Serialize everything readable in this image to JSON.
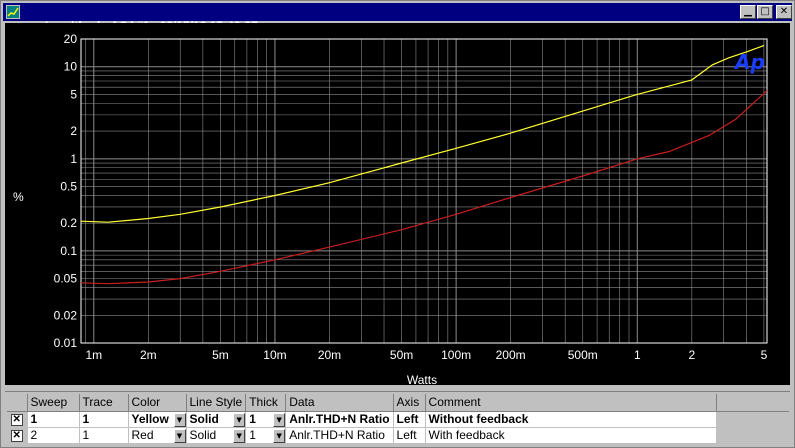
{
  "window": {
    "title_parts": [
      "Loudthud",
      "ACA#1",
      "08/15/12 15:46:27"
    ],
    "controls": [
      "minimize",
      "maximize",
      "close"
    ]
  },
  "chart_data": {
    "type": "line",
    "x_scale": "log",
    "y_scale": "log",
    "xlim": [
      0.00085,
      5.2
    ],
    "ylim": [
      0.01,
      20
    ],
    "xlabel": "Watts",
    "ylabel": "%",
    "x_ticks": [
      {
        "v": 0.001,
        "label": "1m"
      },
      {
        "v": 0.002,
        "label": "2m"
      },
      {
        "v": 0.005,
        "label": "5m"
      },
      {
        "v": 0.01,
        "label": "10m"
      },
      {
        "v": 0.02,
        "label": "20m"
      },
      {
        "v": 0.05,
        "label": "50m"
      },
      {
        "v": 0.1,
        "label": "100m"
      },
      {
        "v": 0.2,
        "label": "200m"
      },
      {
        "v": 0.5,
        "label": "500m"
      },
      {
        "v": 1,
        "label": "1"
      },
      {
        "v": 2,
        "label": "2"
      },
      {
        "v": 5,
        "label": "5"
      }
    ],
    "y_ticks": [
      {
        "v": 20,
        "label": "20"
      },
      {
        "v": 10,
        "label": "10"
      },
      {
        "v": 5,
        "label": "5"
      },
      {
        "v": 2,
        "label": "2"
      },
      {
        "v": 1,
        "label": "1"
      },
      {
        "v": 0.5,
        "label": "0.5"
      },
      {
        "v": 0.2,
        "label": "0.2"
      },
      {
        "v": 0.1,
        "label": "0.1"
      },
      {
        "v": 0.05,
        "label": "0.05"
      },
      {
        "v": 0.02,
        "label": "0.02"
      },
      {
        "v": 0.01,
        "label": "0.01"
      }
    ],
    "grid": true,
    "logo_text": "Ap",
    "series": [
      {
        "color": "#ffff33",
        "x": [
          0.00085,
          0.0012,
          0.002,
          0.003,
          0.005,
          0.01,
          0.02,
          0.05,
          0.1,
          0.2,
          0.5,
          1,
          2,
          2.6,
          3.2,
          4,
          5
        ],
        "y": [
          0.21,
          0.205,
          0.225,
          0.25,
          0.3,
          0.4,
          0.55,
          0.9,
          1.3,
          1.9,
          3.3,
          5.0,
          7.2,
          10.5,
          12.5,
          14.5,
          17
        ]
      },
      {
        "color": "#c81e1e",
        "x": [
          0.00085,
          0.0012,
          0.002,
          0.003,
          0.005,
          0.01,
          0.02,
          0.05,
          0.1,
          0.2,
          0.5,
          1,
          1.5,
          2.5,
          3.5,
          5.2
        ],
        "y": [
          0.045,
          0.044,
          0.046,
          0.05,
          0.06,
          0.08,
          0.11,
          0.17,
          0.25,
          0.38,
          0.65,
          1.0,
          1.2,
          1.8,
          2.7,
          5.5
        ]
      }
    ]
  },
  "sweep_table": {
    "columns": [
      "",
      "Sweep",
      "Trace",
      "Color",
      "Line Style",
      "Thick",
      "Data",
      "Axis",
      "Comment"
    ],
    "rows": [
      {
        "sweep": "1",
        "trace": "1",
        "color": "Yellow",
        "line_style": "Solid",
        "thick": "1",
        "data": "Anlr.THD+N Ratio",
        "axis": "Left",
        "comment": "Without feedback",
        "checked": "✕"
      },
      {
        "sweep": "2",
        "trace": "1",
        "color": "Red",
        "line_style": "Solid",
        "thick": "1",
        "data": "Anlr.THD+N Ratio",
        "axis": "Left",
        "comment": "With feedback",
        "checked": "✕"
      }
    ]
  }
}
